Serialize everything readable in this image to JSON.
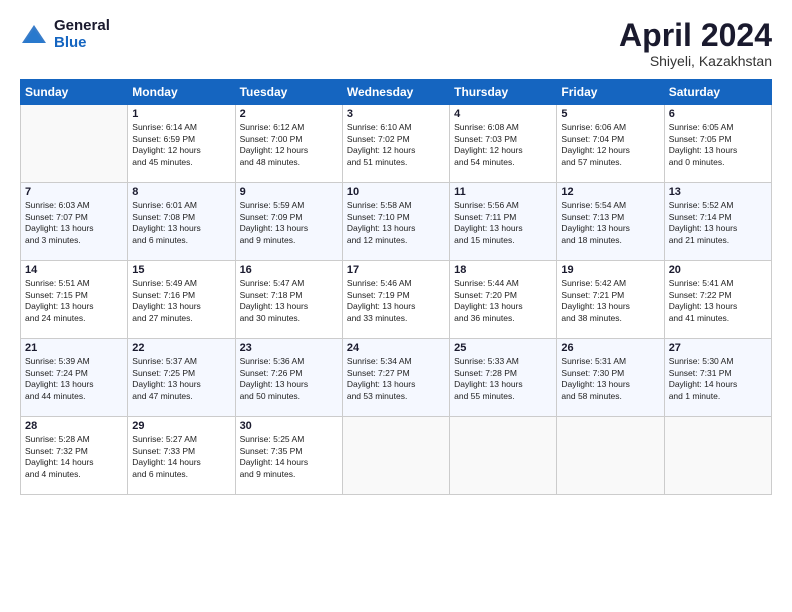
{
  "logo": {
    "general": "General",
    "blue": "Blue"
  },
  "header": {
    "month": "April 2024",
    "location": "Shiyeli, Kazakhstan"
  },
  "days_of_week": [
    "Sunday",
    "Monday",
    "Tuesday",
    "Wednesday",
    "Thursday",
    "Friday",
    "Saturday"
  ],
  "weeks": [
    [
      {
        "day": "",
        "info": ""
      },
      {
        "day": "1",
        "info": "Sunrise: 6:14 AM\nSunset: 6:59 PM\nDaylight: 12 hours\nand 45 minutes."
      },
      {
        "day": "2",
        "info": "Sunrise: 6:12 AM\nSunset: 7:00 PM\nDaylight: 12 hours\nand 48 minutes."
      },
      {
        "day": "3",
        "info": "Sunrise: 6:10 AM\nSunset: 7:02 PM\nDaylight: 12 hours\nand 51 minutes."
      },
      {
        "day": "4",
        "info": "Sunrise: 6:08 AM\nSunset: 7:03 PM\nDaylight: 12 hours\nand 54 minutes."
      },
      {
        "day": "5",
        "info": "Sunrise: 6:06 AM\nSunset: 7:04 PM\nDaylight: 12 hours\nand 57 minutes."
      },
      {
        "day": "6",
        "info": "Sunrise: 6:05 AM\nSunset: 7:05 PM\nDaylight: 13 hours\nand 0 minutes."
      }
    ],
    [
      {
        "day": "7",
        "info": "Sunrise: 6:03 AM\nSunset: 7:07 PM\nDaylight: 13 hours\nand 3 minutes."
      },
      {
        "day": "8",
        "info": "Sunrise: 6:01 AM\nSunset: 7:08 PM\nDaylight: 13 hours\nand 6 minutes."
      },
      {
        "day": "9",
        "info": "Sunrise: 5:59 AM\nSunset: 7:09 PM\nDaylight: 13 hours\nand 9 minutes."
      },
      {
        "day": "10",
        "info": "Sunrise: 5:58 AM\nSunset: 7:10 PM\nDaylight: 13 hours\nand 12 minutes."
      },
      {
        "day": "11",
        "info": "Sunrise: 5:56 AM\nSunset: 7:11 PM\nDaylight: 13 hours\nand 15 minutes."
      },
      {
        "day": "12",
        "info": "Sunrise: 5:54 AM\nSunset: 7:13 PM\nDaylight: 13 hours\nand 18 minutes."
      },
      {
        "day": "13",
        "info": "Sunrise: 5:52 AM\nSunset: 7:14 PM\nDaylight: 13 hours\nand 21 minutes."
      }
    ],
    [
      {
        "day": "14",
        "info": "Sunrise: 5:51 AM\nSunset: 7:15 PM\nDaylight: 13 hours\nand 24 minutes."
      },
      {
        "day": "15",
        "info": "Sunrise: 5:49 AM\nSunset: 7:16 PM\nDaylight: 13 hours\nand 27 minutes."
      },
      {
        "day": "16",
        "info": "Sunrise: 5:47 AM\nSunset: 7:18 PM\nDaylight: 13 hours\nand 30 minutes."
      },
      {
        "day": "17",
        "info": "Sunrise: 5:46 AM\nSunset: 7:19 PM\nDaylight: 13 hours\nand 33 minutes."
      },
      {
        "day": "18",
        "info": "Sunrise: 5:44 AM\nSunset: 7:20 PM\nDaylight: 13 hours\nand 36 minutes."
      },
      {
        "day": "19",
        "info": "Sunrise: 5:42 AM\nSunset: 7:21 PM\nDaylight: 13 hours\nand 38 minutes."
      },
      {
        "day": "20",
        "info": "Sunrise: 5:41 AM\nSunset: 7:22 PM\nDaylight: 13 hours\nand 41 minutes."
      }
    ],
    [
      {
        "day": "21",
        "info": "Sunrise: 5:39 AM\nSunset: 7:24 PM\nDaylight: 13 hours\nand 44 minutes."
      },
      {
        "day": "22",
        "info": "Sunrise: 5:37 AM\nSunset: 7:25 PM\nDaylight: 13 hours\nand 47 minutes."
      },
      {
        "day": "23",
        "info": "Sunrise: 5:36 AM\nSunset: 7:26 PM\nDaylight: 13 hours\nand 50 minutes."
      },
      {
        "day": "24",
        "info": "Sunrise: 5:34 AM\nSunset: 7:27 PM\nDaylight: 13 hours\nand 53 minutes."
      },
      {
        "day": "25",
        "info": "Sunrise: 5:33 AM\nSunset: 7:28 PM\nDaylight: 13 hours\nand 55 minutes."
      },
      {
        "day": "26",
        "info": "Sunrise: 5:31 AM\nSunset: 7:30 PM\nDaylight: 13 hours\nand 58 minutes."
      },
      {
        "day": "27",
        "info": "Sunrise: 5:30 AM\nSunset: 7:31 PM\nDaylight: 14 hours\nand 1 minute."
      }
    ],
    [
      {
        "day": "28",
        "info": "Sunrise: 5:28 AM\nSunset: 7:32 PM\nDaylight: 14 hours\nand 4 minutes."
      },
      {
        "day": "29",
        "info": "Sunrise: 5:27 AM\nSunset: 7:33 PM\nDaylight: 14 hours\nand 6 minutes."
      },
      {
        "day": "30",
        "info": "Sunrise: 5:25 AM\nSunset: 7:35 PM\nDaylight: 14 hours\nand 9 minutes."
      },
      {
        "day": "",
        "info": ""
      },
      {
        "day": "",
        "info": ""
      },
      {
        "day": "",
        "info": ""
      },
      {
        "day": "",
        "info": ""
      }
    ]
  ]
}
